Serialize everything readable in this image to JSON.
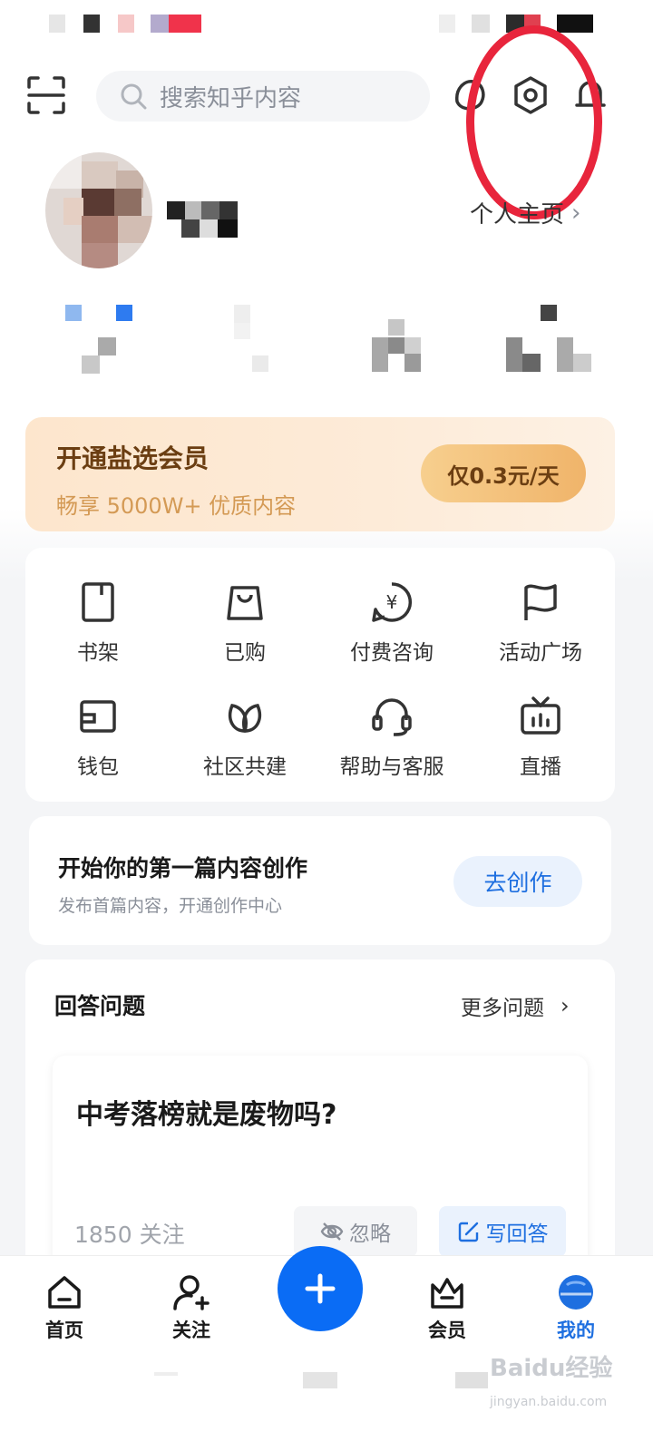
{
  "search": {
    "placeholder": "搜索知乎内容"
  },
  "profile": {
    "homepage_link": "个人主页"
  },
  "vip_banner": {
    "title": "开通盐选会员",
    "subtitle": "畅享 5000W+ 优质内容",
    "button": "仅0.3元/天"
  },
  "tools": [
    {
      "label": "书架",
      "icon": "bookshelf-icon"
    },
    {
      "label": "已购",
      "icon": "shopping-bag-icon"
    },
    {
      "label": "付费咨询",
      "icon": "paid-consult-icon"
    },
    {
      "label": "活动广场",
      "icon": "flag-icon"
    },
    {
      "label": "钱包",
      "icon": "wallet-icon"
    },
    {
      "label": "社区共建",
      "icon": "community-icon"
    },
    {
      "label": "帮助与客服",
      "icon": "headset-icon"
    },
    {
      "label": "直播",
      "icon": "tv-icon"
    }
  ],
  "create": {
    "title": "开始你的第一篇内容创作",
    "subtitle": "发布首篇内容，开通创作中心",
    "button": "去创作"
  },
  "answer": {
    "section_title": "回答问题",
    "more_link": "更多问题",
    "question": "中考落榜就是废物吗?",
    "followers": "1850 关注",
    "ignore_button": "忽略",
    "write_button": "写回答"
  },
  "bottom_nav": [
    {
      "label": "首页",
      "icon": "home-icon"
    },
    {
      "label": "关注",
      "icon": "follow-icon"
    },
    {
      "label": "会员",
      "icon": "vip-icon"
    },
    {
      "label": "我的",
      "icon": "me-icon"
    }
  ],
  "watermark": {
    "brand": "Baidu经验",
    "url": "jingyan.baidu.com"
  },
  "colors": {
    "accent": "#0a6cf5",
    "highlight_circle": "#e8253c",
    "vip_text": "#6b3e12"
  }
}
